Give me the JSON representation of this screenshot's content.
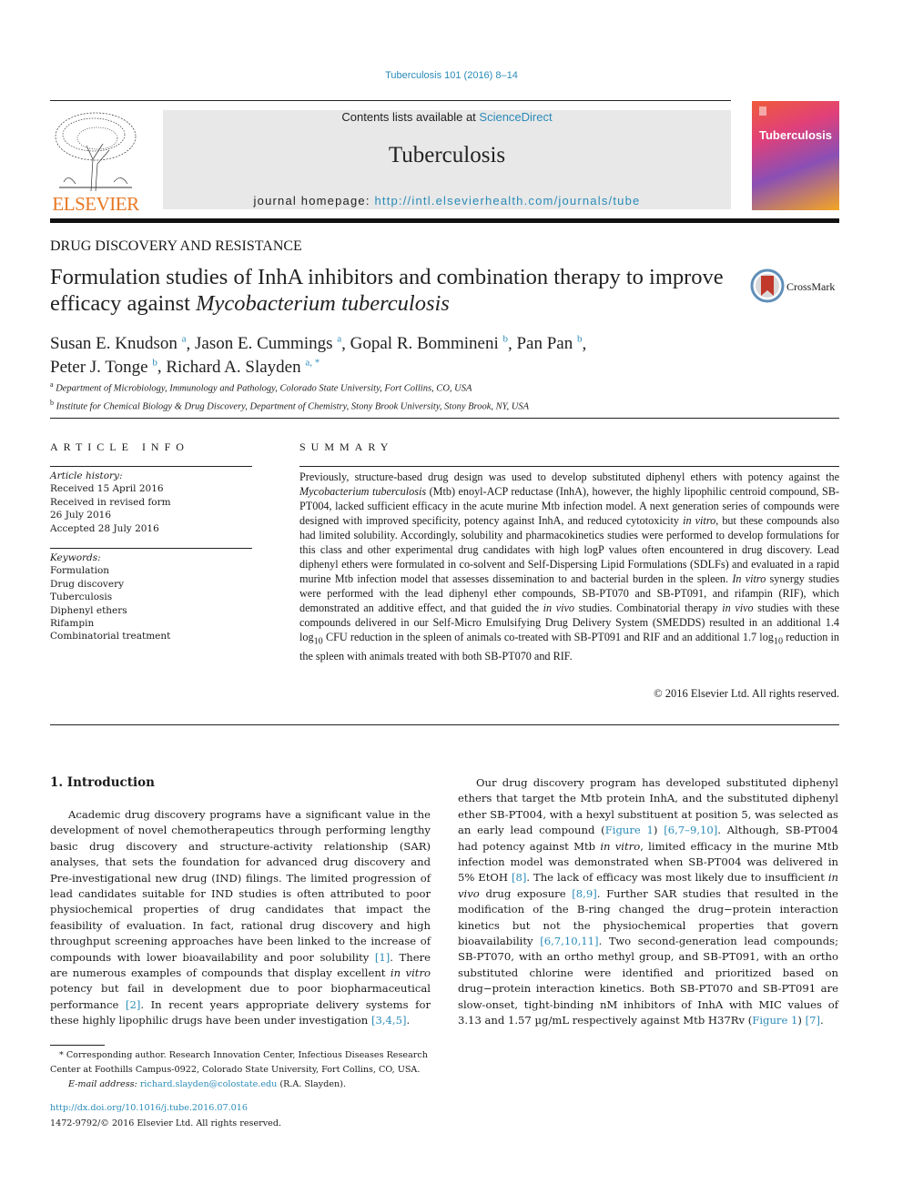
{
  "header": {
    "journal_ref": "Tuberculosis 101 (2016) 8–14",
    "contents_prefix": "Contents lists available at ",
    "contents_link": "ScienceDirect",
    "journal_name": "Tuberculosis",
    "homepage_prefix": "journal homepage: ",
    "homepage_url": "http://intl.elsevierhealth.com/journals/tube",
    "publisher_logo_text": "ELSEVIER",
    "cover_title": "Tuberculosis",
    "crossmark_label": "CrossMark"
  },
  "article": {
    "section": "DRUG DISCOVERY AND RESISTANCE",
    "title_part1": "Formulation studies of InhA inhibitors and combination therapy to improve efficacy against ",
    "title_italic": "Mycobacterium tuberculosis",
    "authors": [
      {
        "name": "Susan E. Knudson",
        "aff": "a",
        "sep": ", "
      },
      {
        "name": "Jason E. Cummings",
        "aff": "a",
        "sep": ", "
      },
      {
        "name": "Gopal R. Bommineni",
        "aff": "b",
        "sep": ", "
      },
      {
        "name": "Pan Pan",
        "aff": "b",
        "sep": ","
      },
      {
        "name": "Peter J. Tonge",
        "aff": "b",
        "sep": ", "
      },
      {
        "name": "Richard A. Slayden",
        "aff": "a, *",
        "sep": ""
      }
    ],
    "affiliations": [
      {
        "key": "a",
        "text": "Department of Microbiology, Immunology and Pathology, Colorado State University, Fort Collins, CO, USA"
      },
      {
        "key": "b",
        "text": "Institute for Chemical Biology & Drug Discovery, Department of Chemistry, Stony Brook University, Stony Brook, NY, USA"
      }
    ]
  },
  "article_info": {
    "heading": "ARTICLE INFO",
    "history_label": "Article history:",
    "history": [
      "Received 15 April 2016",
      "Received in revised form",
      "26 July 2016",
      "Accepted 28 July 2016"
    ],
    "keywords_label": "Keywords:",
    "keywords": [
      "Formulation",
      "Drug discovery",
      "Tuberculosis",
      "Diphenyl ethers",
      "Rifampin",
      "Combinatorial treatment"
    ]
  },
  "summary": {
    "heading": "SUMMARY",
    "s1": "Previously, structure-based drug design was used to develop substituted diphenyl ethers with potency against the ",
    "s1_italic": "Mycobacterium tuberculosis",
    "s2": " (Mtb) enoyl-ACP reductase (InhA), however, the highly lipophilic centroid compound, SB-PT004, lacked sufficient efficacy in the acute murine Mtb infection model. A next generation series of compounds were designed with improved specificity, potency against InhA, and reduced cytotoxicity ",
    "s2_italic": "in vitro",
    "s3": ", but these compounds also had limited solubility. Accordingly, solubility and pharmacokinetics studies were performed to develop formulations for this class and other experimental drug candidates with high logP values often encountered in drug discovery. Lead diphenyl ethers were formulated in co-solvent and Self-Dispersing Lipid Formulations (SDLFs) and evaluated in a rapid murine Mtb infection model that assesses dissemination to and bacterial burden in the spleen. ",
    "s3_italic": "In vitro",
    "s4": " synergy studies were performed with the lead diphenyl ether compounds, SB-PT070 and SB-PT091, and rifampin (RIF), which demonstrated an additive effect, and that guided the ",
    "s4_italic": "in vivo",
    "s5": " studies. Combinatorial therapy ",
    "s5_italic": "in vivo",
    "s6": " studies with these compounds delivered in our Self-Micro Emulsifying Drug Delivery System (SMEDDS) resulted in an additional 1.4 log",
    "sub1": "10",
    "s7": " CFU reduction in the spleen of animals co-treated with SB-PT091 and RIF and an additional 1.7 log",
    "sub2": "10",
    "s8": " reduction in the spleen with animals treated with both SB-PT070 and RIF.",
    "copyright": "© 2016 Elsevier Ltd. All rights reserved."
  },
  "introduction": {
    "heading": "1.  Introduction",
    "p1_a": "Academic drug discovery programs have a significant value in the development of novel chemotherapeutics through performing lengthy basic drug discovery and structure-activity relationship (SAR) analyses, that sets the foundation for advanced drug discovery and Pre-investigational new drug (IND) filings. The limited progression of lead candidates suitable for IND studies is often attributed to poor physiochemical properties of drug candidates that impact the feasibility of evaluation. In fact, rational drug discovery and high throughput screening approaches have been linked to the increase of compounds with lower bioavailability and poor solubility ",
    "ref1": "[1]",
    "p1_b": ". There are numerous examples of compounds that display excellent ",
    "p1_italic": "in vitro",
    "p1_c": " potency but fail in development due to poor biopharmaceutical performance ",
    "ref2": "[2]",
    "p1_d": ". In recent years appropriate delivery systems for these highly lipophilic drugs have been under investigation ",
    "ref3": "[3,4,5]",
    "p1_e": ".",
    "p2_a": "Our drug discovery program has developed substituted diphenyl ethers that target the Mtb protein InhA, and the substituted diphenyl ether SB-PT004, with a hexyl substituent at position 5, was selected as an early lead compound (",
    "fig1": "Figure 1",
    "p2_b": ") ",
    "ref4": "[6,7–9,10]",
    "p2_c": ". Although, SB-PT004 had potency against Mtb ",
    "p2_italic1": "in vitro",
    "p2_d": ", limited efficacy in the murine Mtb infection model was demonstrated when SB-PT004 was delivered in 5% EtOH ",
    "ref5": "[8]",
    "p2_e": ". The lack of efficacy was most likely due to insufficient ",
    "p2_italic2": "in vivo",
    "p2_f": " drug exposure ",
    "ref6": "[8,9]",
    "p2_g": ". Further SAR studies that resulted in the modification of the B-ring changed the drug−protein interaction kinetics but not the physiochemical properties that govern bioavailability ",
    "ref7": "[6,7,10,11]",
    "p2_h": ". Two second-generation lead compounds; SB-PT070, with an ortho methyl group, and SB-PT091, with an ortho substituted chlorine were identified and prioritized based on drug−protein interaction kinetics. Both SB-PT070 and SB-PT091 are slow-onset, tight-binding nM inhibitors of InhA with MIC values of 3.13 and 1.57 µg/mL respectively against Mtb H37Rv (",
    "fig2": "Figure 1",
    "p2_i": ") ",
    "ref8": "[7]",
    "p2_j": "."
  },
  "footnote": {
    "corresponding": "* Corresponding author. Research Innovation Center, Infectious Diseases Research Center at Foothills Campus-0922, Colorado State University, Fort Collins, CO, USA.",
    "email_label": "E-mail address: ",
    "email": "richard.slayden@colostate.edu",
    "email_suffix": " (R.A. Slayden).",
    "doi": "http://dx.doi.org/10.1016/j.tube.2016.07.016",
    "issn": "1472-9792/© 2016 Elsevier Ltd. All rights reserved."
  }
}
